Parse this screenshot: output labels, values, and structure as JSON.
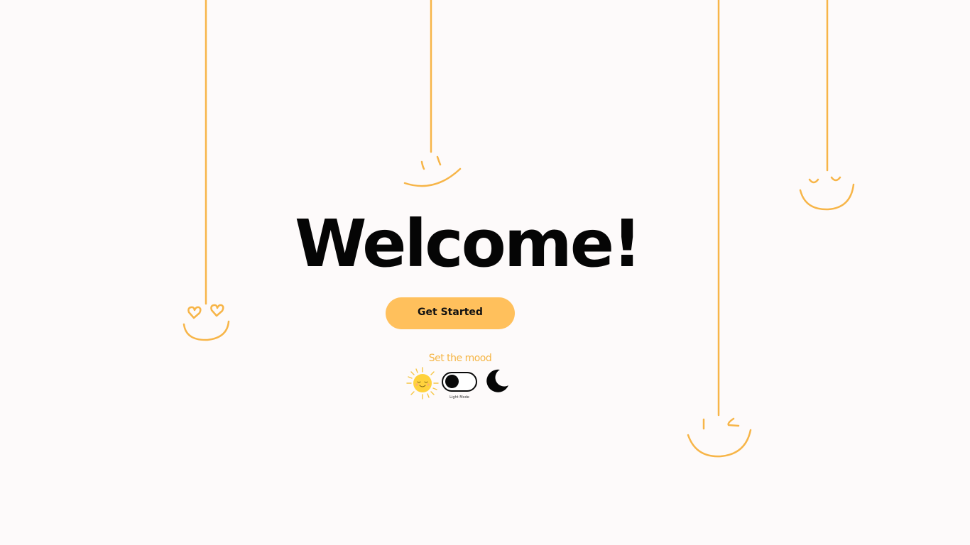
{
  "hero": {
    "title": "Welcome!"
  },
  "cta": {
    "label": "Get Started"
  },
  "mood": {
    "label": "Set the mood",
    "toggle_caption": "Light Mode",
    "toggle_state": "light",
    "left_icon": "sun-icon",
    "right_icon": "moon-icon"
  },
  "decorations": {
    "hanging_faces": [
      "smile-face",
      "heart-eyes-face",
      "wink-face",
      "happy-closed-eyes-face"
    ]
  },
  "colors": {
    "background": "#fdfafa",
    "accent": "#ffc05c",
    "text": "#050505",
    "string": "#f7b548"
  }
}
